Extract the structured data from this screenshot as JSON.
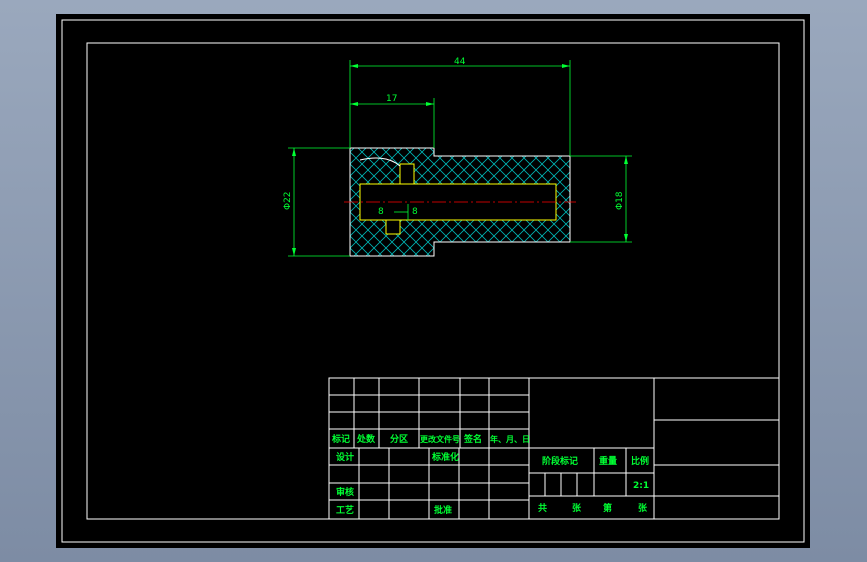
{
  "colors": {
    "background": "#000000",
    "frame": "#ffffff",
    "dimension": "#00ff33",
    "section_outline": "#ffffff",
    "hatch": "#00b4b4",
    "centerline": "#ff0000",
    "hidden_edge": "#ffff00"
  },
  "drawing": {
    "dims": {
      "length_total": "44",
      "length_step": "17",
      "dia_left": "Φ22",
      "dia_right": "Φ18",
      "mark_a": "8",
      "mark_b": "8"
    }
  },
  "title_block": {
    "rev_headers": [
      "标记",
      "处数",
      "分区",
      "更改文件号",
      "签名",
      "年、月、日"
    ],
    "sign_rows": {
      "design": "设计",
      "standardize": "标准化",
      "review": "审核",
      "process": "工艺",
      "approve": "批准"
    },
    "stage_mark": "阶段标记",
    "weight": "重量",
    "scale_label": "比例",
    "scale_value": "2:1",
    "sheets_total": "共",
    "sheet_unit": "张",
    "sheet_no": "第",
    "sheet_unit2": "张"
  }
}
